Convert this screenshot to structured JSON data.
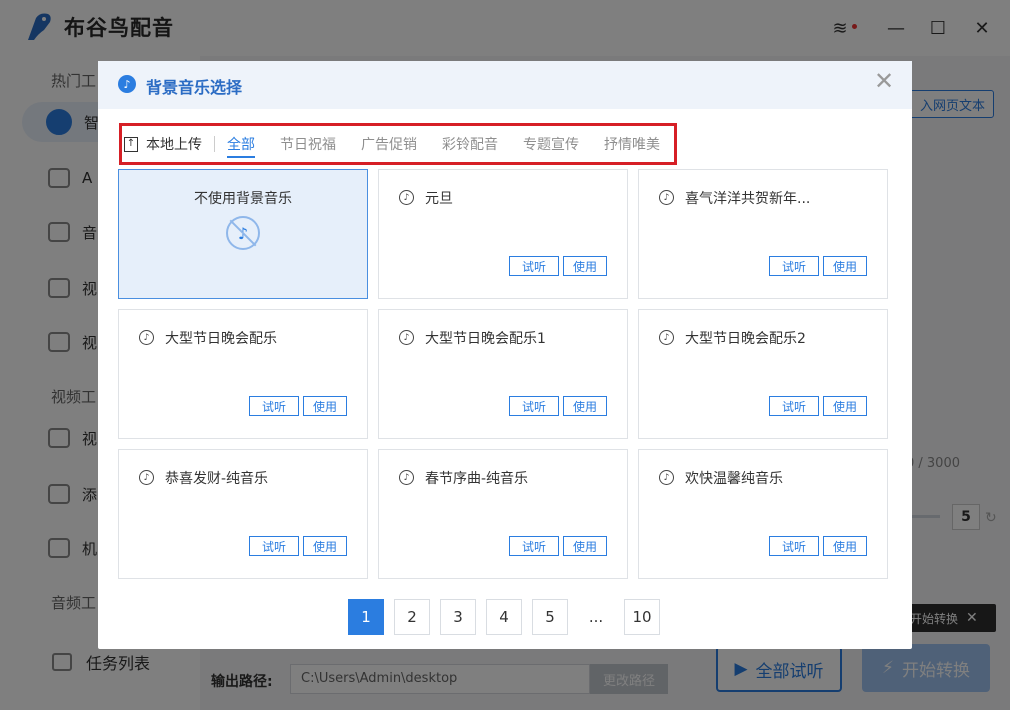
{
  "app": {
    "title": "布谷鸟配音"
  },
  "sidebar": {
    "section_hot": "热门工",
    "items": [
      {
        "label": "智"
      },
      {
        "label": "A"
      },
      {
        "label": "音"
      },
      {
        "label": "视"
      },
      {
        "label": "视"
      }
    ],
    "section_video": "视频工",
    "items2": [
      {
        "label": "视"
      },
      {
        "label": "添"
      },
      {
        "label": "机"
      }
    ],
    "section_audio": "音频工",
    "task_list": "任务列表"
  },
  "main": {
    "import_button": "入网页文本",
    "char_count": "0 / 3000",
    "speed_value": "5",
    "tip_text": "开始转换",
    "output_label": "输出路径:",
    "output_path": "C:\\Users\\Admin\\desktop",
    "change_path": "更改路径",
    "listen_all": "全部试听",
    "start_convert": "开始转换"
  },
  "modal": {
    "title": "背景音乐选择",
    "upload_label": "本地上传",
    "tabs": [
      "全部",
      "节日祝福",
      "广告促销",
      "彩铃配音",
      "专题宣传",
      "抒情唯美"
    ],
    "active_tab": "全部",
    "try_label": "试听",
    "use_label": "使用",
    "no_music_label": "不使用背景音乐",
    "tracks": [
      "元旦",
      "喜气洋洋共贺新年...",
      "大型节日晚会配乐",
      "大型节日晚会配乐1",
      "大型节日晚会配乐2",
      "恭喜发财-纯音乐",
      "春节序曲-纯音乐",
      "欢快温馨纯音乐"
    ],
    "pages": [
      "1",
      "2",
      "3",
      "4",
      "5",
      "...",
      "10"
    ],
    "current_page": "1"
  },
  "colors": {
    "accent": "#2b7de0",
    "highlight_border": "#d61f26"
  }
}
